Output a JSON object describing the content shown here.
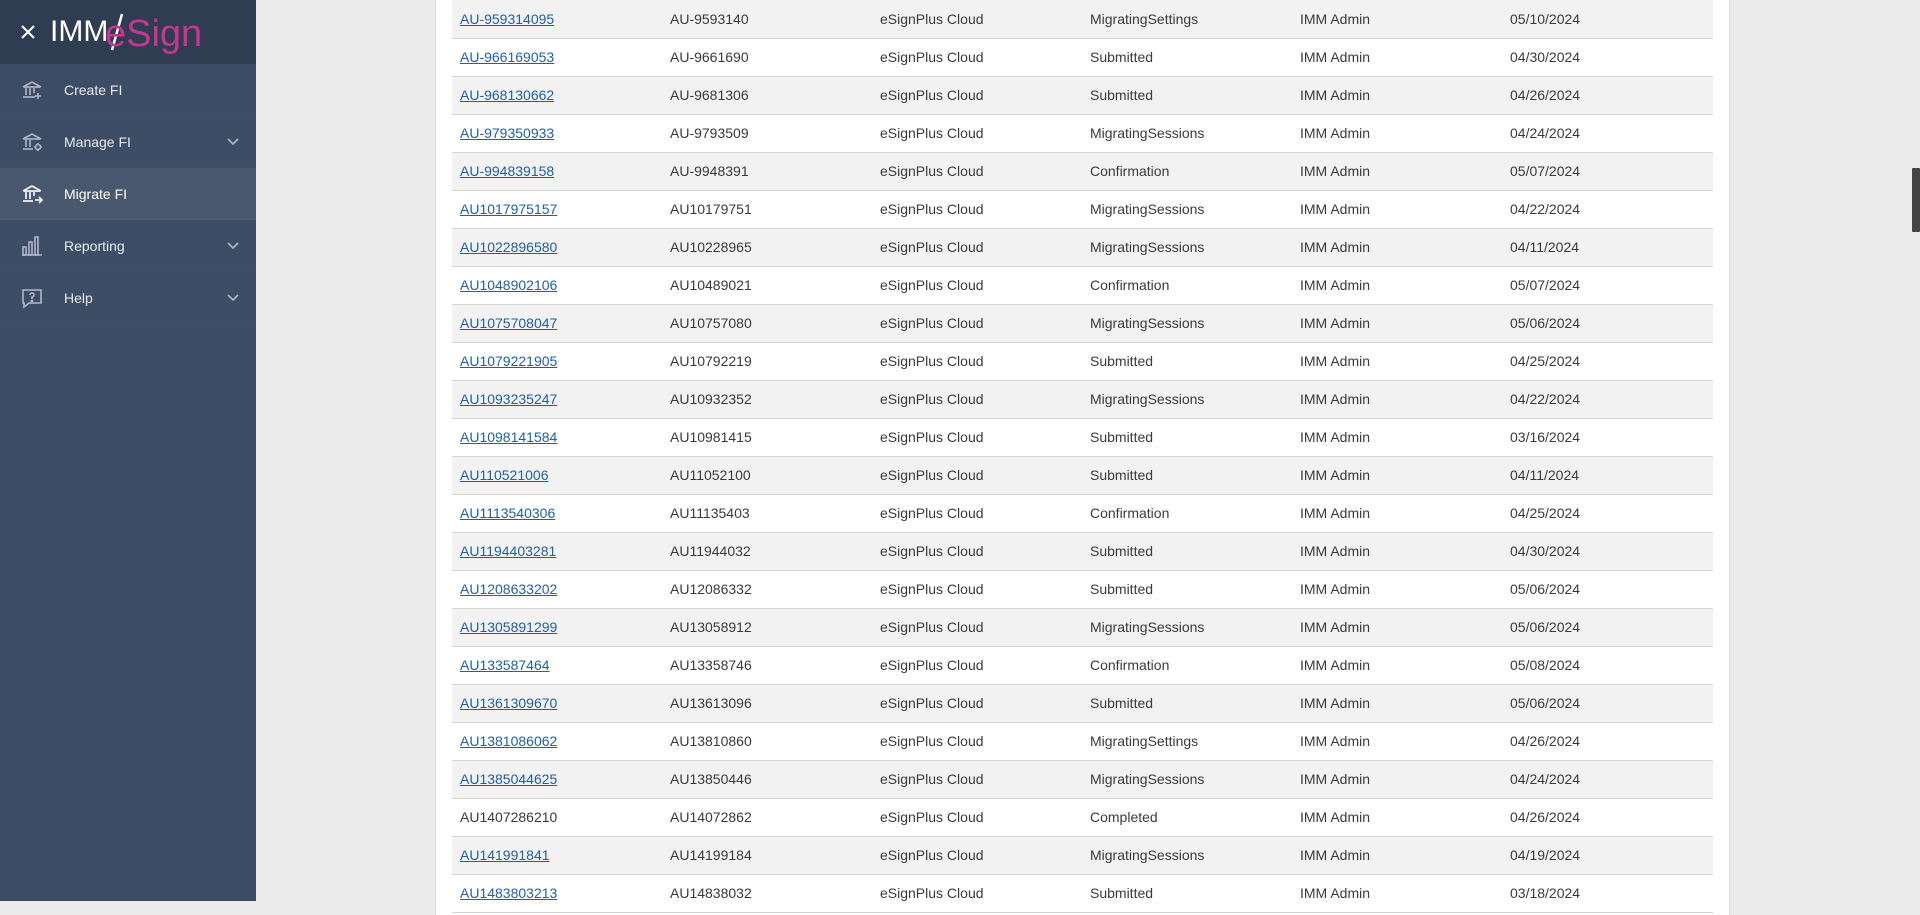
{
  "app": {
    "logo_imm": "IMM",
    "logo_esign": "eSign",
    "colors": {
      "sidebar": "#3e4d66",
      "sidebar_header": "#2f3c52",
      "active_item": "#4a586f",
      "link": "#1f5fa8",
      "logo_pink": "#c2378f"
    }
  },
  "sidebar": {
    "items": [
      {
        "label": "Create FI",
        "icon": "bank-plus-icon",
        "has_chevron": false,
        "active": false
      },
      {
        "label": "Manage FI",
        "icon": "bank-settings-icon",
        "has_chevron": true,
        "active": false
      },
      {
        "label": "Migrate FI",
        "icon": "bank-migrate-icon",
        "has_chevron": false,
        "active": true
      },
      {
        "label": "Reporting",
        "icon": "bar-chart-icon",
        "has_chevron": true,
        "active": false
      },
      {
        "label": "Help",
        "icon": "help-bubble-icon",
        "has_chevron": true,
        "active": false
      }
    ]
  },
  "table": {
    "rows": [
      {
        "id": "AU-959314095",
        "link": true,
        "code": "AU-9593140",
        "platform": "eSignPlus Cloud",
        "status": "MigratingSettings",
        "user": "IMM Admin",
        "date": "05/10/2024"
      },
      {
        "id": "AU-966169053",
        "link": true,
        "code": "AU-9661690",
        "platform": "eSignPlus Cloud",
        "status": "Submitted",
        "user": "IMM Admin",
        "date": "04/30/2024"
      },
      {
        "id": "AU-968130662",
        "link": true,
        "code": "AU-9681306",
        "platform": "eSignPlus Cloud",
        "status": "Submitted",
        "user": "IMM Admin",
        "date": "04/26/2024"
      },
      {
        "id": "AU-979350933",
        "link": true,
        "code": "AU-9793509",
        "platform": "eSignPlus Cloud",
        "status": "MigratingSessions",
        "user": "IMM Admin",
        "date": "04/24/2024"
      },
      {
        "id": "AU-994839158",
        "link": true,
        "code": "AU-9948391",
        "platform": "eSignPlus Cloud",
        "status": "Confirmation",
        "user": "IMM Admin",
        "date": "05/07/2024"
      },
      {
        "id": "AU1017975157",
        "link": true,
        "code": "AU10179751",
        "platform": "eSignPlus Cloud",
        "status": "MigratingSessions",
        "user": "IMM Admin",
        "date": "04/22/2024"
      },
      {
        "id": "AU1022896580",
        "link": true,
        "code": "AU10228965",
        "platform": "eSignPlus Cloud",
        "status": "MigratingSessions",
        "user": "IMM Admin",
        "date": "04/11/2024"
      },
      {
        "id": "AU1048902106",
        "link": true,
        "code": "AU10489021",
        "platform": "eSignPlus Cloud",
        "status": "Confirmation",
        "user": "IMM Admin",
        "date": "05/07/2024"
      },
      {
        "id": "AU1075708047",
        "link": true,
        "code": "AU10757080",
        "platform": "eSignPlus Cloud",
        "status": "MigratingSessions",
        "user": "IMM Admin",
        "date": "05/06/2024"
      },
      {
        "id": "AU1079221905",
        "link": true,
        "code": "AU10792219",
        "platform": "eSignPlus Cloud",
        "status": "Submitted",
        "user": "IMM Admin",
        "date": "04/25/2024"
      },
      {
        "id": "AU1093235247",
        "link": true,
        "code": "AU10932352",
        "platform": "eSignPlus Cloud",
        "status": "MigratingSessions",
        "user": "IMM Admin",
        "date": "04/22/2024"
      },
      {
        "id": "AU1098141584",
        "link": true,
        "code": "AU10981415",
        "platform": "eSignPlus Cloud",
        "status": "Submitted",
        "user": "IMM Admin",
        "date": "03/16/2024"
      },
      {
        "id": "AU110521006",
        "link": true,
        "code": "AU11052100",
        "platform": "eSignPlus Cloud",
        "status": "Submitted",
        "user": "IMM Admin",
        "date": "04/11/2024"
      },
      {
        "id": "AU1113540306",
        "link": true,
        "code": "AU11135403",
        "platform": "eSignPlus Cloud",
        "status": "Confirmation",
        "user": "IMM Admin",
        "date": "04/25/2024"
      },
      {
        "id": "AU1194403281",
        "link": true,
        "code": "AU11944032",
        "platform": "eSignPlus Cloud",
        "status": "Submitted",
        "user": "IMM Admin",
        "date": "04/30/2024"
      },
      {
        "id": "AU1208633202",
        "link": true,
        "code": "AU12086332",
        "platform": "eSignPlus Cloud",
        "status": "Submitted",
        "user": "IMM Admin",
        "date": "05/06/2024"
      },
      {
        "id": "AU1305891299",
        "link": true,
        "code": "AU13058912",
        "platform": "eSignPlus Cloud",
        "status": "MigratingSessions",
        "user": "IMM Admin",
        "date": "05/06/2024"
      },
      {
        "id": "AU133587464",
        "link": true,
        "code": "AU13358746",
        "platform": "eSignPlus Cloud",
        "status": "Confirmation",
        "user": "IMM Admin",
        "date": "05/08/2024"
      },
      {
        "id": "AU1361309670",
        "link": true,
        "code": "AU13613096",
        "platform": "eSignPlus Cloud",
        "status": "Submitted",
        "user": "IMM Admin",
        "date": "05/06/2024"
      },
      {
        "id": "AU1381086062",
        "link": true,
        "code": "AU13810860",
        "platform": "eSignPlus Cloud",
        "status": "MigratingSettings",
        "user": "IMM Admin",
        "date": "04/26/2024"
      },
      {
        "id": "AU1385044625",
        "link": true,
        "code": "AU13850446",
        "platform": "eSignPlus Cloud",
        "status": "MigratingSessions",
        "user": "IMM Admin",
        "date": "04/24/2024"
      },
      {
        "id": "AU1407286210",
        "link": false,
        "code": "AU14072862",
        "platform": "eSignPlus Cloud",
        "status": "Completed",
        "user": "IMM Admin",
        "date": "04/26/2024"
      },
      {
        "id": "AU141991841",
        "link": true,
        "code": "AU14199184",
        "platform": "eSignPlus Cloud",
        "status": "MigratingSessions",
        "user": "IMM Admin",
        "date": "04/19/2024"
      },
      {
        "id": "AU1483803213",
        "link": true,
        "code": "AU14838032",
        "platform": "eSignPlus Cloud",
        "status": "Submitted",
        "user": "IMM Admin",
        "date": "03/18/2024"
      }
    ]
  }
}
